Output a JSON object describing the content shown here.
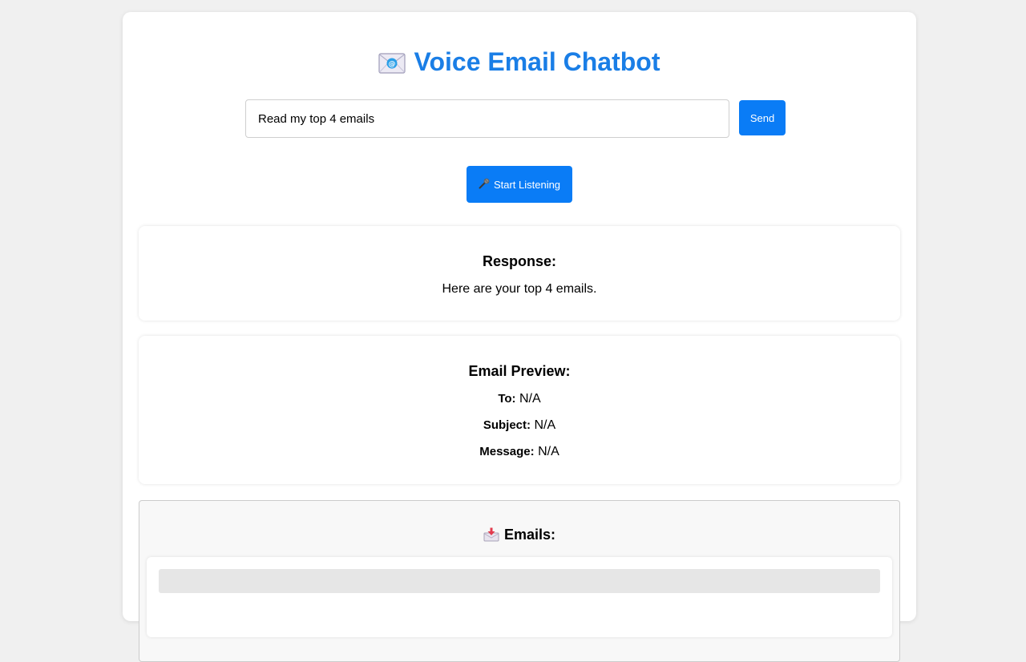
{
  "header": {
    "title": "Voice Email Chatbot",
    "title_icon": "envelope-icon",
    "accent_color": "#1a7ee6"
  },
  "query": {
    "value": "Read my top 4 emails",
    "send_label": "Send"
  },
  "voice": {
    "listen_label": "Start Listening",
    "listen_icon": "microphone-icon"
  },
  "response": {
    "heading": "Response:",
    "text": "Here are your top 4 emails."
  },
  "preview": {
    "heading": "Email Preview:",
    "to_label": "To:",
    "to_value": "N/A",
    "subject_label": "Subject:",
    "subject_value": "N/A",
    "message_label": "Message:",
    "message_value": "N/A"
  },
  "emails": {
    "heading": "Emails:",
    "icon": "inbox-tray-icon"
  },
  "colors": {
    "button": "#0a7cf6",
    "page_background": "#f0f0f0"
  }
}
